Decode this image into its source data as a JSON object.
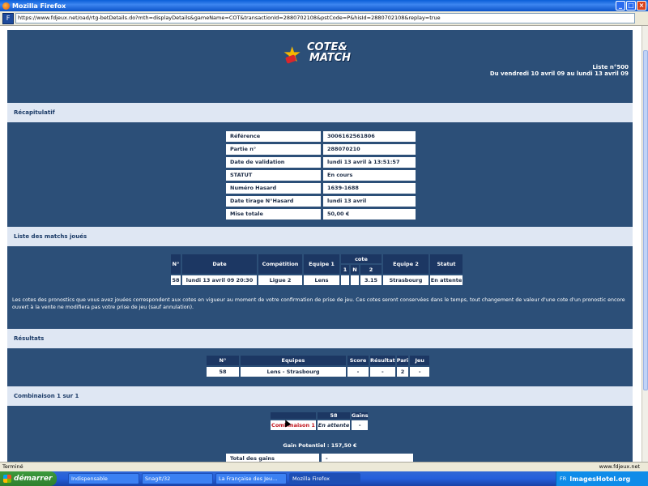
{
  "window": {
    "title": "Mozilla Firefox"
  },
  "browser": {
    "url": "https://www.fdjeux.net/oad/rtg-betDetails.do?mth=displayDetails&gameName=COT&transactionId=2880702108&pstCode=P&hisId=2880702108&replay=true",
    "status": "Terminé",
    "status_right": "www.fdjeux.net"
  },
  "logo": {
    "line1": "COTE&",
    "line2": "MATCH"
  },
  "list_info": {
    "line1": "Liste n°500",
    "line2": "Du vendredi 10 avril 09 au lundi 13 avril 09"
  },
  "sections": {
    "recap": "Récapitulatif",
    "matches": "Liste des matchs joués",
    "results": "Résultats",
    "combo": "Combinaison 1 sur 1"
  },
  "recap": [
    {
      "k": "Référence",
      "v": "3006162561806"
    },
    {
      "k": "Partie n°",
      "v": "288070210"
    },
    {
      "k": "Date de validation",
      "v": "lundi 13 avril à 13:51:57"
    },
    {
      "k": "STATUT",
      "v": "En cours"
    },
    {
      "k": "Numéro Hasard",
      "v": "1639-1688"
    },
    {
      "k": "Date tirage N°Hasard",
      "v": "lundi 13 avril"
    },
    {
      "k": "Mise totale",
      "v": "50,00 €"
    }
  ],
  "matches": {
    "headers": {
      "num": "N°",
      "date": "Date",
      "comp": "Compétition",
      "eq1": "Equipe 1",
      "cote": "cote",
      "c1": "1",
      "cn": "N",
      "c2": "2",
      "eq2": "Equipe 2",
      "status": "Statut"
    },
    "row": {
      "num": "58",
      "date": "lundi 13 avril 09 20:30",
      "comp": "Ligue 2",
      "eq1": "Lens",
      "c1": "",
      "cn": "",
      "c2": "3.15",
      "eq2": "Strasbourg",
      "status": "En attente"
    }
  },
  "note": "Les cotes des pronostics que vous avez jouées correspondent aux cotes en vigueur au moment de votre confirmation de prise de jeu. Ces cotes seront conservées dans le temps, tout changement de valeur d'une cote d'un pronostic encore ouvert à la vente ne modifiera pas votre prise de jeu (sauf annulation).",
  "results": {
    "headers": {
      "num": "N°",
      "teams": "Equipes",
      "score": "Score",
      "result": "Résultat",
      "pari": "Pari",
      "jeu": "Jeu"
    },
    "row": {
      "num": "58",
      "teams": "Lens - Strasbourg",
      "score": "-",
      "result": "-",
      "pari": "2",
      "jeu": "-"
    }
  },
  "combo": {
    "headers": {
      "blank": "",
      "num": "58",
      "gains": "Gains"
    },
    "row": {
      "label": "Combinaison 1",
      "state": "En attente",
      "gains": "-"
    },
    "gain_potentiel": "Gain Potentiel : 157,50 €",
    "total_label": "Total des gains",
    "total_value": "-"
  },
  "taskbar": {
    "start": "démarrer",
    "tasks": [
      "Indispensable",
      "SnagIt/32",
      "La Française des Jeu...",
      "Mozilla Firefox"
    ],
    "tray_lang": "FR",
    "watermark": "ImagesHotel.org"
  }
}
